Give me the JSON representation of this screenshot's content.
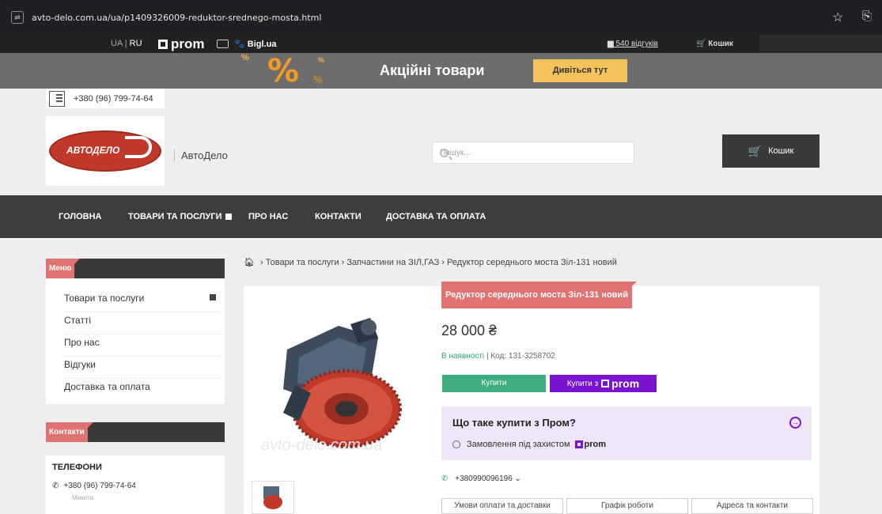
{
  "browser": {
    "url": "avto-delo.com.ua/ua/p1409326009-reduktor-srednego-mosta.html"
  },
  "prom_strip": {
    "lang_ua": "UA",
    "lang_sep": "|",
    "lang_ru": "RU",
    "prom_logo": "prom",
    "bigl": "Bigl.ua",
    "reviews": "540 відгуків",
    "cart": "Кошик"
  },
  "promo": {
    "symbol": "%",
    "title": "Акційні товари",
    "button": "Дивіться тут"
  },
  "header": {
    "phone": "+380 (96) 799-74-64",
    "logo_text": "АВТОДЕЛО",
    "brand_name": "АвтоДело",
    "search_placeholder": "Пошук...",
    "cart_label": "Кошик"
  },
  "nav": {
    "items": [
      "ГОЛОВНА",
      "ТОВАРИ ТА ПОСЛУГИ",
      "ПРО НАС",
      "КОНТАКТИ",
      "ДОСТАВКА ТА ОПЛАТА"
    ]
  },
  "sidebar": {
    "menu_title": "Меню",
    "menu_items": [
      "Товари та послуги",
      "Статті",
      "Про нас",
      "Відгуки",
      "Доставка та оплата"
    ],
    "contacts_title": "Контакти",
    "phones_title": "ТЕЛЕФОНИ",
    "phone": "+380 (96) 799-74-64",
    "phone_sub": "Микита"
  },
  "breadcrumb": {
    "items": [
      "Товари та послуги",
      "Запчастини на ЗІЛ,ГАЗ",
      "Редуктор середнього моста Зіл-131 новий"
    ]
  },
  "product": {
    "title": "Редуктор середнього моста Зіл-131 новий",
    "price": "28 000 ₴",
    "availability": "В наявності",
    "code": "Код: 131-3258702",
    "buy_label": "Купити",
    "buy_prom_label": "Купити з",
    "buy_prom_brand": "prom",
    "watermark": "avto-delo.com.ua",
    "prom_info_title": "Що таке купити з Пром?",
    "prom_info_sub": "Замовлення під захистом",
    "prom_info_brand": "prom",
    "seller_phone": "+380990096196",
    "tabs": [
      "Умови оплати та доставки",
      "Графік роботи",
      "Адреса та контакти"
    ]
  },
  "colors": {
    "accent_red": "#e07272",
    "buy_green": "#3fae7f",
    "prom_purple": "#7b14d1",
    "promo_button": "#f4c25a"
  }
}
